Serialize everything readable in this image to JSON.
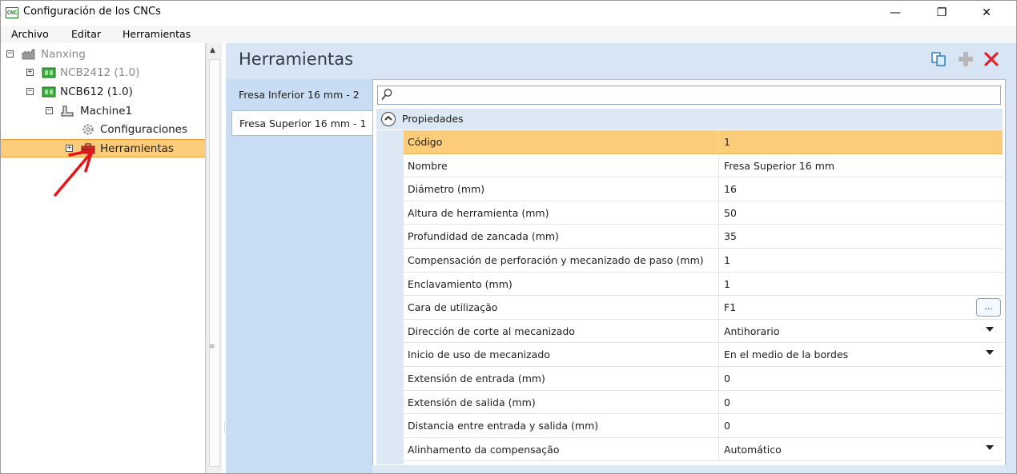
{
  "window": {
    "title": "Configuración de los CNCs",
    "icon_text": "CNC",
    "controls": {
      "minimize": "—",
      "maximize": "❐",
      "close": "✕"
    }
  },
  "menu": [
    "Archivo",
    "Editar",
    "Herramientas"
  ],
  "tree": {
    "root": {
      "label": "Nanxing",
      "expander": "⊟"
    },
    "items": [
      {
        "label": "NCB2412 (1.0)",
        "expander": "+"
      },
      {
        "label": "NCB612 (1.0)",
        "expander": "−"
      },
      {
        "label": "Machine1",
        "expander": "−"
      },
      {
        "label": "Configuraciones"
      },
      {
        "label": "Herramientas",
        "expander": "+",
        "selected": true
      }
    ]
  },
  "header": {
    "title": "Herramientas"
  },
  "tools": [
    {
      "label": "Fresa Inferior 16 mm - 2"
    },
    {
      "label": "Fresa Superior 16 mm - 1",
      "active": true
    }
  ],
  "properties": {
    "search_placeholder": "",
    "category": "Propiedades",
    "rows": [
      {
        "name": "Código",
        "value": "1",
        "selected": true
      },
      {
        "name": "Nombre",
        "value": "Fresa Superior 16 mm"
      },
      {
        "name": "Diámetro (mm)",
        "value": "16"
      },
      {
        "name": "Altura de herramienta (mm)",
        "value": "50"
      },
      {
        "name": "Profundidad de zancada (mm)",
        "value": "35"
      },
      {
        "name": "Compensación de perforación y mecanizado de paso (mm)",
        "value": "1"
      },
      {
        "name": "Enclavamiento (mm)",
        "value": "1"
      },
      {
        "name": "Cara de utilização",
        "value": "F1",
        "editor": "ellipsis",
        "editor_label": "..."
      },
      {
        "name": "Dirección de corte al mecanizado",
        "value": "Antihorario",
        "editor": "dropdown"
      },
      {
        "name": "Inicio de uso de mecanizado",
        "value": "En el medio de la bordes",
        "editor": "dropdown"
      },
      {
        "name": "Extensión de entrada (mm)",
        "value": "0"
      },
      {
        "name": "Extensión de salida (mm)",
        "value": "0"
      },
      {
        "name": "Distancia entre entrada y salida (mm)",
        "value": "0"
      },
      {
        "name": "Alinhamento da compensação",
        "value": "Automático",
        "editor": "dropdown"
      }
    ]
  },
  "colors": {
    "selection": "#fbcd7a",
    "panel_bg": "#d7e5f5",
    "delete": "#e0242a",
    "annotation_arrow": "#e8141c"
  }
}
